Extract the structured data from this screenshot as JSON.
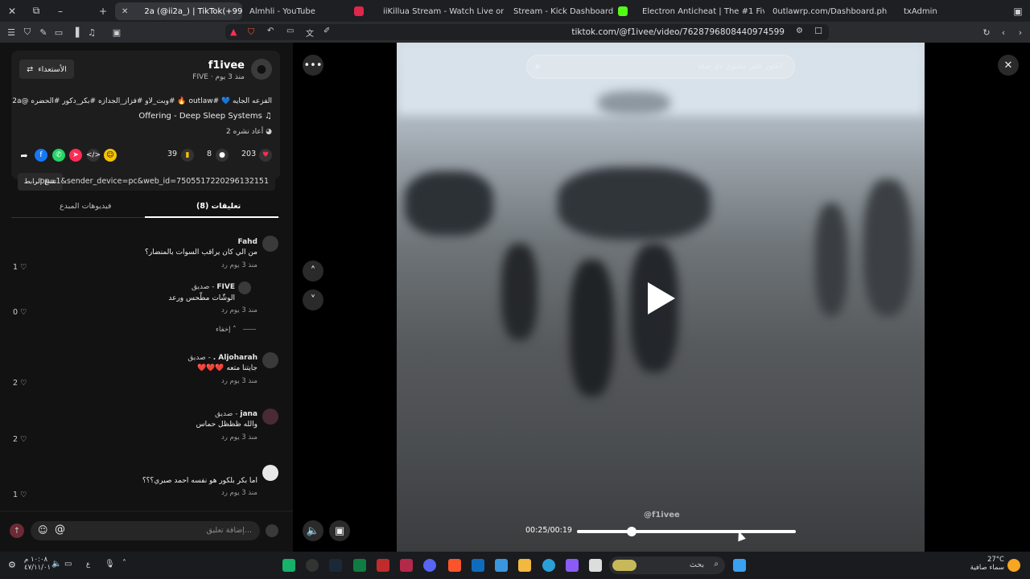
{
  "browser": {
    "tabs": [
      {
        "title": "2a (@ii2a_) | TikTok(+99)",
        "active": true
      },
      {
        "title": "Almhli - YouTube",
        "active": false
      },
      {
        "title": "iiKillua Stream - Watch Live on K",
        "active": false
      },
      {
        "title": "Stream - Kick Dashboard",
        "active": false
      },
      {
        "title": "Electron Anticheat | The #1 FiveM A",
        "active": false
      },
      {
        "title": "0utlawrp.com/Dashboard.php",
        "active": false
      },
      {
        "title": "txAdmin",
        "active": false
      }
    ],
    "address": "tiktok.com/@f1ivee/video/7628796808440974599",
    "colors": {
      "accent": "#fe2c55",
      "kick": "#53fc18"
    }
  },
  "post": {
    "follow_label": "الأستعداء",
    "author": "f1ivee",
    "author_meta": "FIVE · منذ 3 يوم",
    "caption": "الفزعه الجايه 💙 #outlaw 🔥 #وبت_لاو #فزاز_الجدازه #بكر_دكور #الحضره @2a",
    "music": "Offering - Deep Sleep Systems",
    "reposts": "2 أعاد نشره",
    "likes": "203",
    "comments": "8",
    "saves": "39",
    "copy_link_label": "نسخ الرابط",
    "link": "...pp=1&sender_device=pc&web_id=7505517220296132151",
    "tab_comments": "تعليقات (8)",
    "tab_creator_videos": "فيديوهات المبدع"
  },
  "comments": [
    {
      "name": "Fahd",
      "text": "من الي كان يراقب السوات بالمنضار؟",
      "meta": "منذ 3 يوم   رد",
      "likes": "1"
    },
    {
      "name": "FIVE",
      "badge": "صديق",
      "text": "الوشّات مطّحس ورعد",
      "meta": "منذ 3 يوم   رد",
      "likes": "0",
      "reply": true
    },
    {
      "name": "Aljoharah .",
      "badge": "صديق",
      "text": "جايتنا متعه ❤️❤️❤️",
      "meta": "منذ 3 يوم   رد",
      "likes": "2"
    },
    {
      "name": "jana",
      "badge": "صديق",
      "text": "والله ظظظل حماس",
      "meta": "منذ 3 يوم   رد",
      "likes": "2"
    },
    {
      "name": "",
      "text": "اما بكر بلكور هو نفسه احمد صبري؟؟؟",
      "meta": "منذ 3 يوم   رد",
      "likes": "1"
    }
  ],
  "hide_replies": "إخفاء",
  "composer_placeholder": "إضافة تعليق...",
  "video": {
    "search_placeholder": "العثور على محتوى ذي صلة",
    "watermark": "@f1ivee",
    "time": "00:25/00:19",
    "progress": 0.25
  },
  "taskbar": {
    "search_placeholder": "بحث",
    "time": "١٠:٠٨ م",
    "date": "٤٧/١١/٠١",
    "weather_temp": "27°C",
    "weather_text": "سماء صافية",
    "lang": "ع"
  }
}
